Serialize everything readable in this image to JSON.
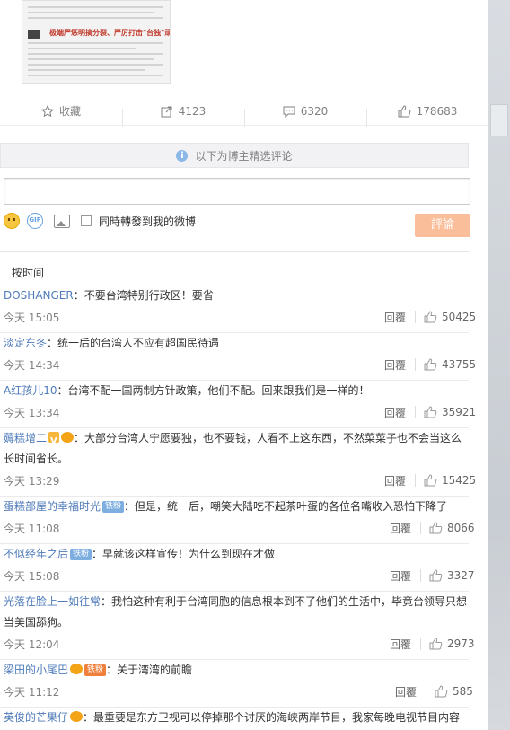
{
  "post": {
    "thumb_caption": "极端严惩明搞分裂、严厉打击\"台独\"顽固分子"
  },
  "actions": {
    "favorite": "收藏",
    "repost_count": "4123",
    "comment_count": "6320",
    "like_count": "178683"
  },
  "notice": {
    "text": "以下为博主精选评论"
  },
  "composer": {
    "placeholder": "",
    "repost_checkbox_label": "同時轉發到我的微博",
    "submit_label": "評論",
    "gif_label": "GIF"
  },
  "sort": {
    "label": "按时间"
  },
  "reply_label": "回覆",
  "comments": [
    {
      "user": "DOSHANGER",
      "text": "：不要台湾特别行政区！要省",
      "time": "今天 15:05",
      "likes": "50425"
    },
    {
      "user": "淡定东冬",
      "text": "：统一后的台湾人不应有超国民待遇",
      "time": "今天 14:34",
      "likes": "43755"
    },
    {
      "user": "A红孩儿10",
      "text": "：台湾不配一国两制方针政策，他们不配。回来跟我们是一样的！",
      "time": "今天 13:34",
      "likes": "35921"
    },
    {
      "user": "薅糕增二",
      "text": "：大部分台湾人宁愿要独，也不要钱，人看不上这东西，不然菜菜子也不会当这么",
      "text2": "长时间省长。",
      "time": "今天 13:29",
      "likes": "15425"
    },
    {
      "user": "蛋糕部屋的幸福时光",
      "badge": "铁粉",
      "text": "：但是，统一后，嘲笑大陆吃不起茶叶蛋的各位名嘴收入恐怕下降了",
      "time": "今天 11:08",
      "likes": "8066"
    },
    {
      "user": "不似经年之后",
      "badge": "铁粉",
      "text": "：早就该这样宣传！为什么到现在才做",
      "time": "今天 15:08",
      "likes": "3327"
    },
    {
      "user": "光落在脸上一如往常",
      "text": "：我怕这种有利于台湾同胞的信息根本到不了他们的生活中，毕竟台领导只想",
      "text2": "当美国舔狗。",
      "time": "今天 12:04",
      "likes": "2973"
    },
    {
      "user": "梁田的小尾巴",
      "badge": "铁粉",
      "text": "：关于湾湾的前瞻",
      "time": "今天 11:12",
      "likes": "585"
    },
    {
      "user": "英俊的芒果仔",
      "text": "：最重要是东方卫视可以停掉那个讨厌的海峡两岸节目，我家每晚电视节目内容"
    }
  ]
}
